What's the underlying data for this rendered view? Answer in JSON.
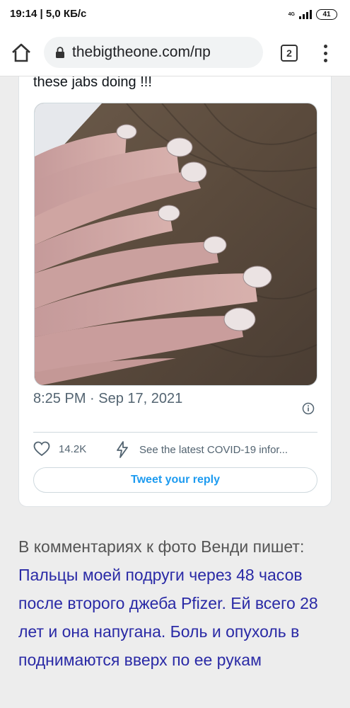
{
  "status_bar": {
    "time_speed": "19:14 | 5,0 КБ/с",
    "network_top": "4G",
    "network_bottom": "ıl",
    "battery": "41"
  },
  "browser": {
    "url": "thebigtheone.com/пр",
    "tab_count": "2",
    "icons": [
      "home-icon",
      "lock-icon",
      "more-vert-icon"
    ]
  },
  "tweet": {
    "text_fragment": "these jabs doing !!!",
    "photo_alt": "hand-photo",
    "timestamp": "8:25 PM · Sep 17, 2021",
    "likes": "14.2K",
    "covid_link": "See the latest COVID-19 infor...",
    "reply_label": "Tweet your reply",
    "colors": {
      "accent": "#1d9bf0",
      "muted": "#536471"
    }
  },
  "article": {
    "intro": "В комментариях к фото Венди пишет: ",
    "quote": "Пальцы моей подруги  через 48 часов после второго джеба Pfizer. Ей всего 28 лет и она напугана. Боль и опухоль в поднимаются вверх по ее рукам"
  }
}
